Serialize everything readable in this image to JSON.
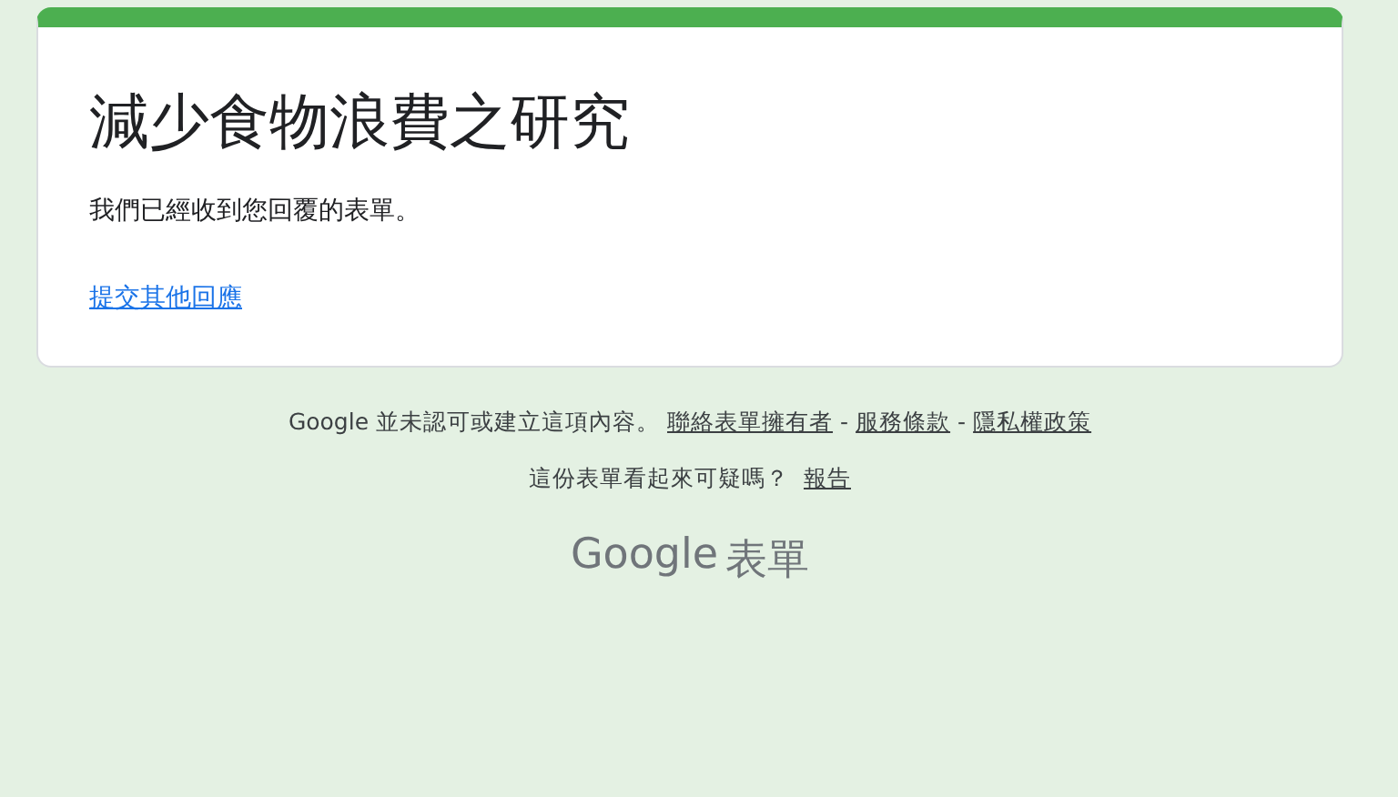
{
  "form": {
    "title": "減少食物浪費之研究",
    "message": "我們已經收到您回覆的表單。",
    "another_response_link": "提交其他回應"
  },
  "footer": {
    "disclaimer": "Google 並未認可或建立這項內容。",
    "links": [
      "聯絡表單擁有者",
      "服務條款",
      "隱私權政策"
    ],
    "separator": "-",
    "report_question": "這份表單看起來可疑嗎？",
    "report_link": "報告",
    "logo_brand": "Google",
    "logo_product": "表單"
  }
}
